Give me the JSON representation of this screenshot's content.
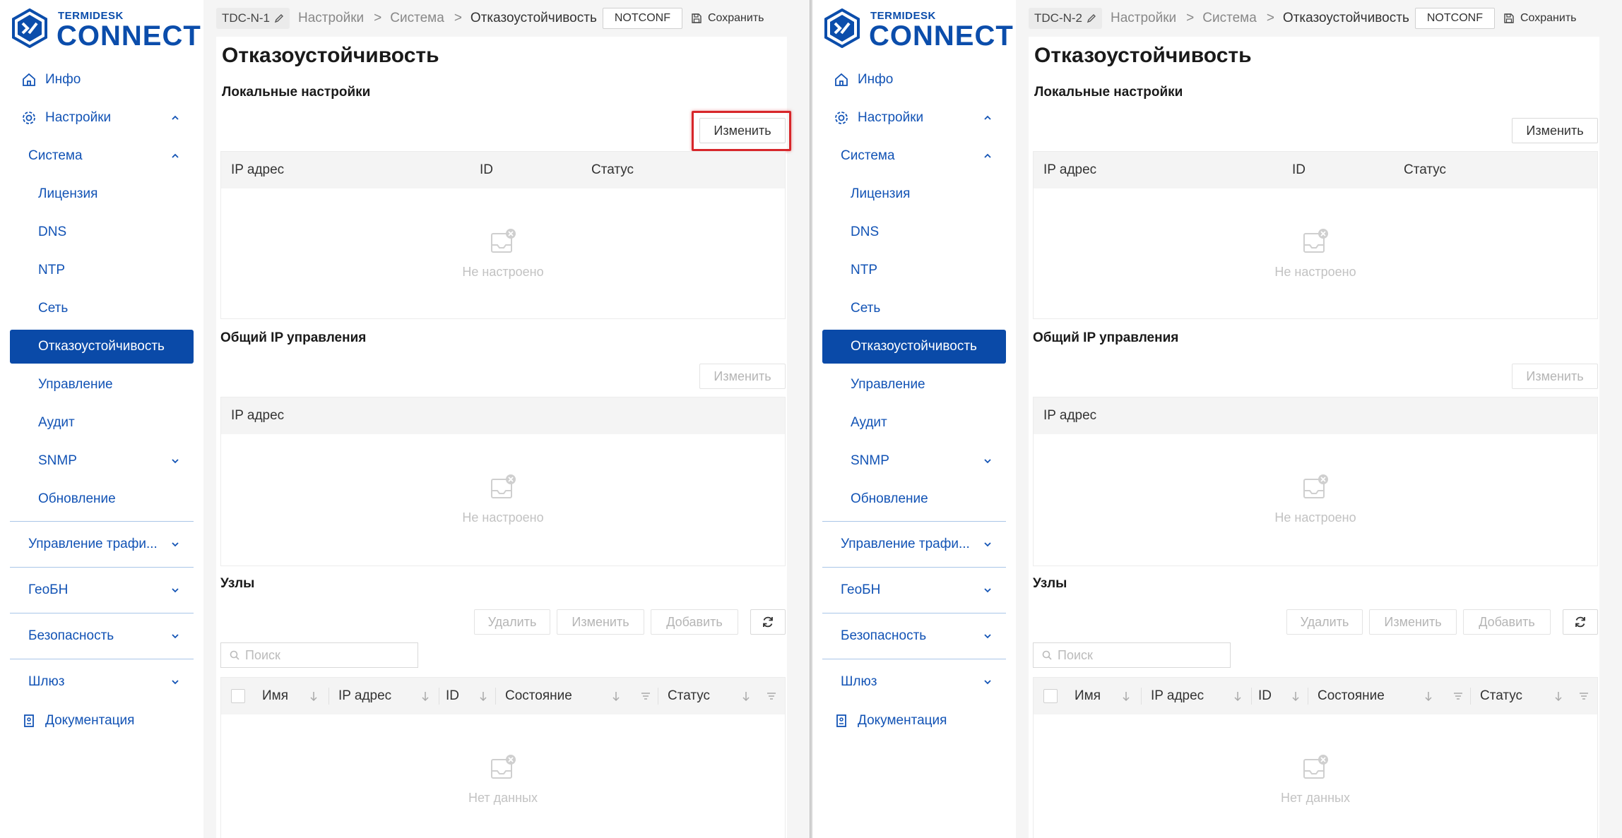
{
  "panes": [
    {
      "brand": {
        "small": "TERMIDESK",
        "big": "CONNECT"
      },
      "nav": {
        "info": "Инфо",
        "settings": "Настройки",
        "system": "Система",
        "license": "Лицензия",
        "dns": "DNS",
        "ntp": "NTP",
        "network": "Сеть",
        "failover": "Отказоустойчивость",
        "management": "Управление",
        "audit": "Аудит",
        "snmp": "SNMP",
        "update": "Обновление",
        "traffic": "Управление трафи...",
        "geobn": "ГеоБН",
        "security": "Безопасность",
        "gateway": "Шлюз",
        "docs": "Документация"
      },
      "header": {
        "node": "TDC-N-1",
        "crumb1": "Настройки",
        "sep": ">",
        "crumb2": "Система",
        "crumb3": "Отказоустойчивость",
        "status": "NOTCONF",
        "save": "Сохранить"
      },
      "main": {
        "title": "Отказоустойчивость",
        "local": {
          "title": "Локальные настройки",
          "edit": "Изменить",
          "columns": [
            "IP адрес",
            "ID",
            "Статус"
          ],
          "empty": "Не настроено"
        },
        "shared": {
          "title": "Общий IP управления",
          "edit": "Изменить",
          "columns": [
            "IP адрес"
          ],
          "empty": "Не настроено"
        },
        "nodes": {
          "title": "Узлы",
          "delete": "Удалить",
          "edit": "Изменить",
          "add": "Добавить",
          "search_placeholder": "Поиск",
          "columns": [
            "Имя",
            "IP адрес",
            "ID",
            "Состояние",
            "Статус"
          ],
          "empty": "Нет данных"
        }
      }
    },
    {
      "brand": {
        "small": "TERMIDESK",
        "big": "CONNECT"
      },
      "nav": {
        "info": "Инфо",
        "settings": "Настройки",
        "system": "Система",
        "license": "Лицензия",
        "dns": "DNS",
        "ntp": "NTP",
        "network": "Сеть",
        "failover": "Отказоустойчивость",
        "management": "Управление",
        "audit": "Аудит",
        "snmp": "SNMP",
        "update": "Обновление",
        "traffic": "Управление трафи...",
        "geobn": "ГеоБН",
        "security": "Безопасность",
        "gateway": "Шлюз",
        "docs": "Документация"
      },
      "header": {
        "node": "TDC-N-2",
        "crumb1": "Настройки",
        "sep": ">",
        "crumb2": "Система",
        "crumb3": "Отказоустойчивость",
        "status": "NOTCONF",
        "save": "Сохранить"
      },
      "main": {
        "title": "Отказоустойчивость",
        "local": {
          "title": "Локальные настройки",
          "edit": "Изменить",
          "columns": [
            "IP адрес",
            "ID",
            "Статус"
          ],
          "empty": "Не настроено"
        },
        "shared": {
          "title": "Общий IP управления",
          "edit": "Изменить",
          "columns": [
            "IP адрес"
          ],
          "empty": "Не настроено"
        },
        "nodes": {
          "title": "Узлы",
          "delete": "Удалить",
          "edit": "Изменить",
          "add": "Добавить",
          "search_placeholder": "Поиск",
          "columns": [
            "Имя",
            "IP адрес",
            "ID",
            "Состояние",
            "Статус"
          ],
          "empty": "Нет данных"
        }
      }
    }
  ],
  "colors": {
    "brand": "#0b4dab",
    "active_nav": "#0a4aa8",
    "highlight": "#d7262a"
  }
}
